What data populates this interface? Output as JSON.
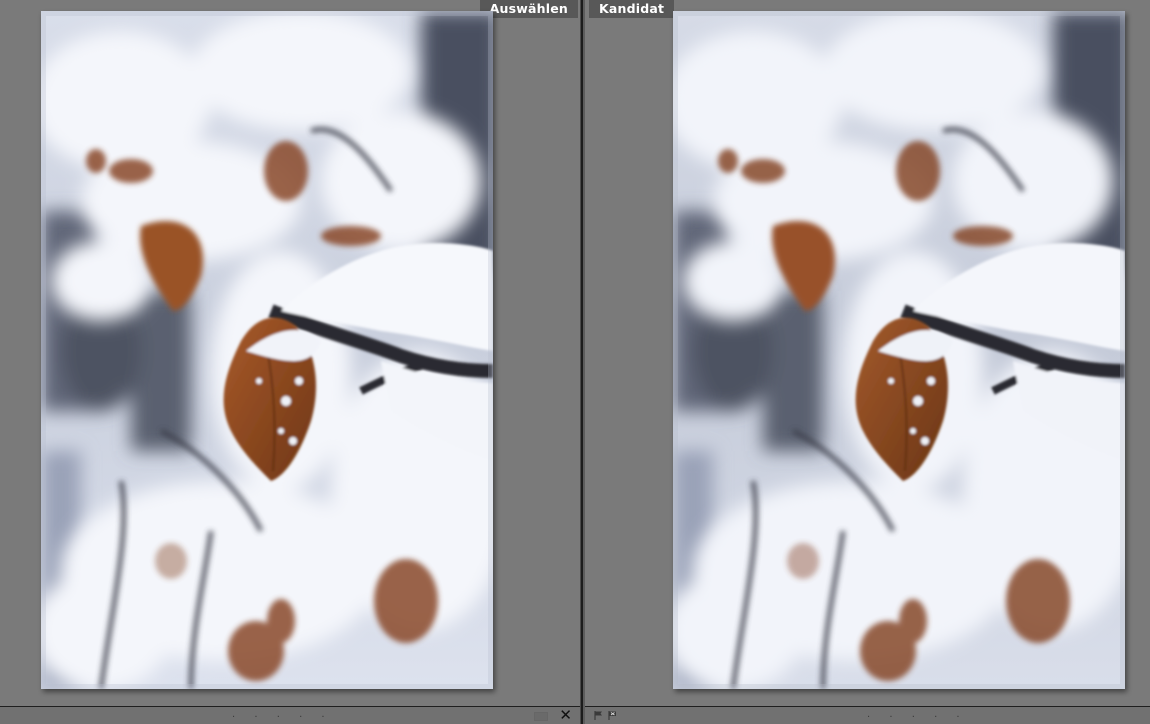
{
  "left_pane": {
    "label": "Auswählen",
    "photo_name": "snow-leaf-photo-select",
    "footer_dots": ". . . . ."
  },
  "right_pane": {
    "label": "Kandidat",
    "photo_name": "snow-leaf-photo-candidate",
    "footer_dots": ". . . . ."
  },
  "footer": {
    "close_glyph": "✕"
  },
  "icons": {
    "close": "close-icon",
    "flag": "flag-icon",
    "reject_flag": "reject-flag-icon"
  },
  "colors": {
    "background": "#7d7d7d",
    "tag": "#585858",
    "tag_text": "#ffffff",
    "leaf": "#8f4a21",
    "snow": "#eef1f8"
  }
}
